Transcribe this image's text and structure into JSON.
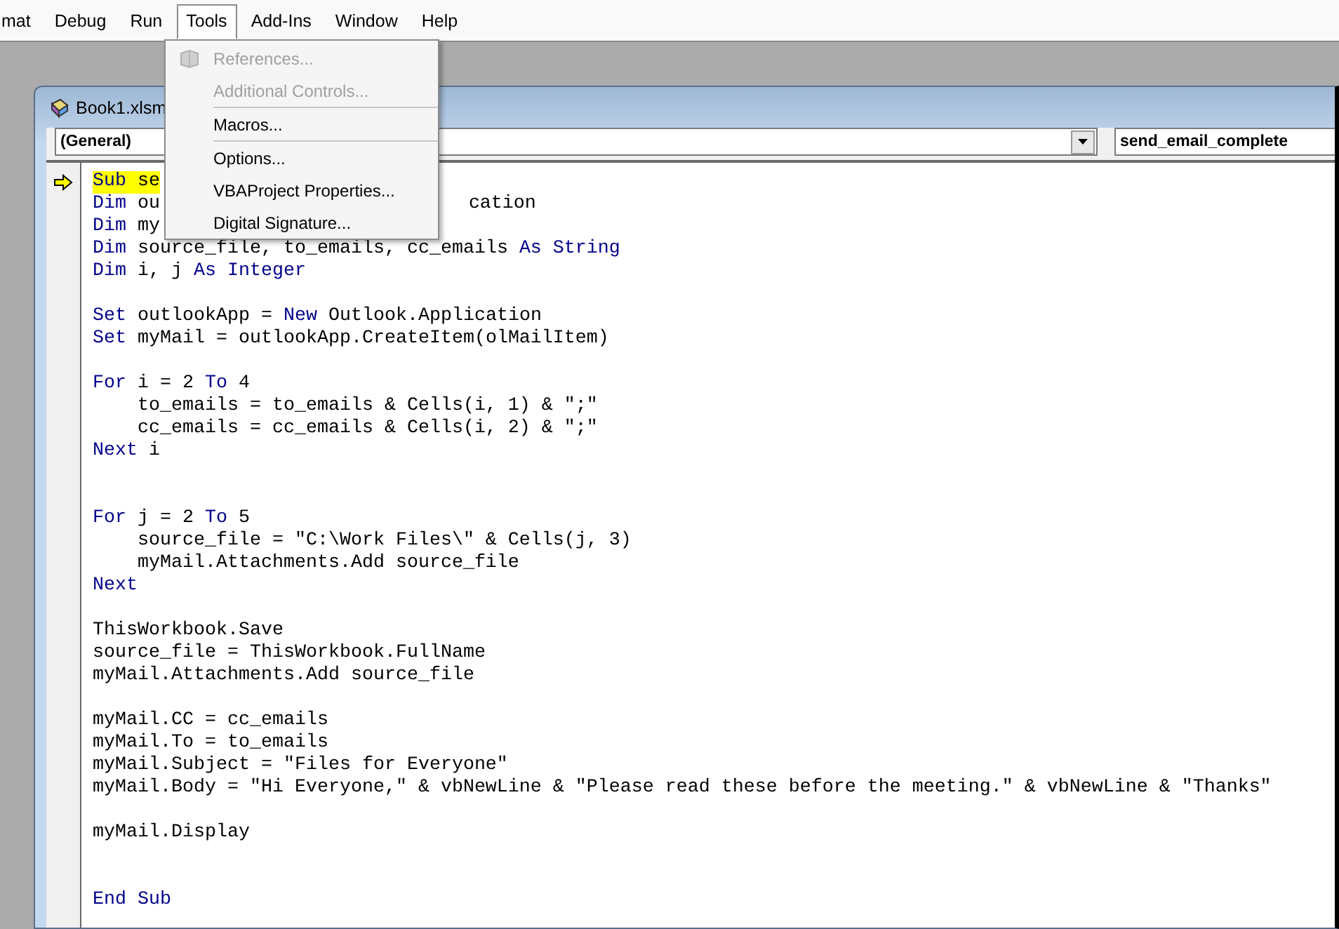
{
  "menu_bar": [
    {
      "label": "mat",
      "selected": false
    },
    {
      "label": "Debug",
      "selected": false
    },
    {
      "label": "Run",
      "selected": false
    },
    {
      "label": "Tools",
      "selected": true
    },
    {
      "label": "Add-Ins",
      "selected": false
    },
    {
      "label": "Window",
      "selected": false
    },
    {
      "label": "Help",
      "selected": false
    }
  ],
  "tools_menu": [
    {
      "kind": "item",
      "label": "References...",
      "disabled": true,
      "icon": true
    },
    {
      "kind": "item",
      "label": "Additional Controls...",
      "disabled": true,
      "icon": false
    },
    {
      "kind": "separator"
    },
    {
      "kind": "item",
      "label": "Macros...",
      "disabled": false,
      "icon": false
    },
    {
      "kind": "separator"
    },
    {
      "kind": "item",
      "label": "Options...",
      "disabled": false,
      "icon": false
    },
    {
      "kind": "item",
      "label": "VBAProject Properties...",
      "disabled": false,
      "icon": false
    },
    {
      "kind": "item",
      "label": "Digital Signature...",
      "disabled": false,
      "icon": false
    }
  ],
  "code_window": {
    "title": "Book1.xlsm",
    "object_combo": "(General)",
    "procedure_combo": "send_email_complete",
    "lines": [
      {
        "kind": "code",
        "current": true,
        "tokens": [
          {
            "kind": "keyword",
            "text": "Sub"
          },
          {
            "kind": "plain",
            "text": " se"
          }
        ]
      },
      {
        "kind": "code",
        "current": false,
        "tokens": [
          {
            "kind": "keyword",
            "text": "Dim"
          },
          {
            "kind": "plain",
            "text": " ou"
          }
        ],
        "after_menu": "cation"
      },
      {
        "kind": "code",
        "current": false,
        "tokens": [
          {
            "kind": "keyword",
            "text": "Dim"
          },
          {
            "kind": "plain",
            "text": " my"
          }
        ]
      },
      {
        "kind": "code",
        "current": false,
        "tokens": [
          {
            "kind": "keyword",
            "text": "Dim"
          },
          {
            "kind": "plain",
            "text": " source_file, to_emails, cc_emails "
          },
          {
            "kind": "keyword",
            "text": "As String"
          }
        ]
      },
      {
        "kind": "code",
        "current": false,
        "tokens": [
          {
            "kind": "keyword",
            "text": "Dim"
          },
          {
            "kind": "plain",
            "text": " i, j "
          },
          {
            "kind": "keyword",
            "text": "As Integer"
          }
        ]
      },
      {
        "kind": "blank"
      },
      {
        "kind": "code",
        "current": false,
        "tokens": [
          {
            "kind": "keyword",
            "text": "Set"
          },
          {
            "kind": "plain",
            "text": " outlookApp = "
          },
          {
            "kind": "keyword",
            "text": "New"
          },
          {
            "kind": "plain",
            "text": " Outlook.Application"
          }
        ]
      },
      {
        "kind": "code",
        "current": false,
        "tokens": [
          {
            "kind": "keyword",
            "text": "Set"
          },
          {
            "kind": "plain",
            "text": " myMail = outlookApp.CreateItem(olMailItem)"
          }
        ]
      },
      {
        "kind": "blank"
      },
      {
        "kind": "code",
        "current": false,
        "tokens": [
          {
            "kind": "keyword",
            "text": "For"
          },
          {
            "kind": "plain",
            "text": " i = 2 "
          },
          {
            "kind": "keyword",
            "text": "To"
          },
          {
            "kind": "plain",
            "text": " 4"
          }
        ]
      },
      {
        "kind": "code",
        "current": false,
        "tokens": [
          {
            "kind": "plain",
            "text": "    to_emails = to_emails & Cells(i, 1) & \";\""
          }
        ]
      },
      {
        "kind": "code",
        "current": false,
        "tokens": [
          {
            "kind": "plain",
            "text": "    cc_emails = cc_emails & Cells(i, 2) & \";\""
          }
        ]
      },
      {
        "kind": "code",
        "current": false,
        "tokens": [
          {
            "kind": "keyword",
            "text": "Next"
          },
          {
            "kind": "plain",
            "text": " i"
          }
        ]
      },
      {
        "kind": "blank"
      },
      {
        "kind": "blank"
      },
      {
        "kind": "code",
        "current": false,
        "tokens": [
          {
            "kind": "keyword",
            "text": "For"
          },
          {
            "kind": "plain",
            "text": " j = 2 "
          },
          {
            "kind": "keyword",
            "text": "To"
          },
          {
            "kind": "plain",
            "text": " 5"
          }
        ]
      },
      {
        "kind": "code",
        "current": false,
        "tokens": [
          {
            "kind": "plain",
            "text": "    source_file = \"C:\\Work Files\\\" & Cells(j, 3)"
          }
        ]
      },
      {
        "kind": "code",
        "current": false,
        "tokens": [
          {
            "kind": "plain",
            "text": "    myMail.Attachments.Add source_file"
          }
        ]
      },
      {
        "kind": "code",
        "current": false,
        "tokens": [
          {
            "kind": "keyword",
            "text": "Next"
          }
        ]
      },
      {
        "kind": "blank"
      },
      {
        "kind": "code",
        "current": false,
        "tokens": [
          {
            "kind": "plain",
            "text": "ThisWorkbook.Save"
          }
        ]
      },
      {
        "kind": "code",
        "current": false,
        "tokens": [
          {
            "kind": "plain",
            "text": "source_file = ThisWorkbook.FullName"
          }
        ]
      },
      {
        "kind": "code",
        "current": false,
        "tokens": [
          {
            "kind": "plain",
            "text": "myMail.Attachments.Add source_file"
          }
        ]
      },
      {
        "kind": "blank"
      },
      {
        "kind": "code",
        "current": false,
        "tokens": [
          {
            "kind": "plain",
            "text": "myMail.CC = cc_emails"
          }
        ]
      },
      {
        "kind": "code",
        "current": false,
        "tokens": [
          {
            "kind": "plain",
            "text": "myMail.To = to_emails"
          }
        ]
      },
      {
        "kind": "code",
        "current": false,
        "tokens": [
          {
            "kind": "plain",
            "text": "myMail.Subject = \"Files for Everyone\""
          }
        ]
      },
      {
        "kind": "code",
        "current": false,
        "tokens": [
          {
            "kind": "plain",
            "text": "myMail.Body = \"Hi Everyone,\" & vbNewLine & \"Please read these before the meeting.\" & vbNewLine & \"Thanks\""
          }
        ]
      },
      {
        "kind": "blank"
      },
      {
        "kind": "code",
        "current": false,
        "tokens": [
          {
            "kind": "plain",
            "text": "myMail.Display"
          }
        ]
      },
      {
        "kind": "blank"
      },
      {
        "kind": "blank"
      },
      {
        "kind": "code",
        "current": false,
        "tokens": [
          {
            "kind": "keyword",
            "text": "End Sub"
          }
        ]
      }
    ]
  }
}
